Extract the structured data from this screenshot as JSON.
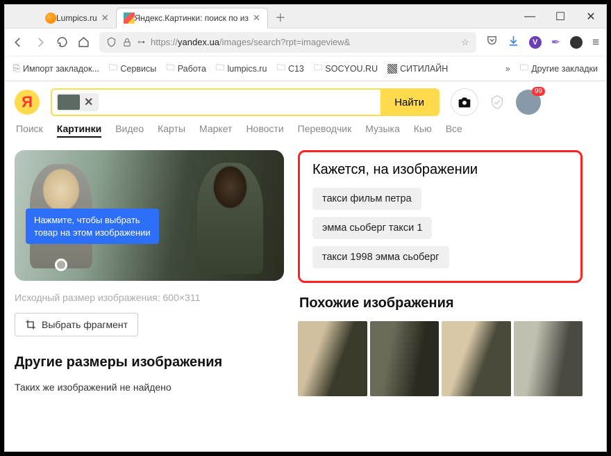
{
  "tabs": [
    {
      "title": "Lumpics.ru"
    },
    {
      "title": "Яндекс.Картинки: поиск по из"
    }
  ],
  "url": {
    "proto": "https://",
    "host": "yandex.ua",
    "path": "/images/search?rpt=imageview&"
  },
  "bookmarks": {
    "imp": "Импорт закладок...",
    "items": [
      "Сервисы",
      "Работа",
      "lumpics.ru",
      "C13",
      "SOCYOU.RU",
      "СИТИЛАЙН"
    ],
    "other": "Другие закладки"
  },
  "search": {
    "btn": "Найти"
  },
  "avatar": {
    "badge": "99"
  },
  "services": [
    "Поиск",
    "Картинки",
    "Видео",
    "Карты",
    "Маркет",
    "Новости",
    "Переводчик",
    "Музыка",
    "Кью",
    "Все"
  ],
  "cbir": {
    "hintL1": "Нажмите, чтобы выбрать",
    "hintL2": "товар на этом изображении",
    "origPrefix": "Исходный размер изображения: ",
    "origSize": "600×311",
    "crop": "Выбрать фрагмент"
  },
  "suggested": {
    "title": "Кажется, на изображении",
    "tags": [
      "такси фильм петра",
      "эмма сьоберг такси 1",
      "такси 1998 эмма сьоберг"
    ]
  },
  "similar": {
    "title": "Похожие изображения"
  },
  "otherSizes": {
    "title": "Другие размеры изображения",
    "msg": "Таких же изображений не найдено"
  }
}
